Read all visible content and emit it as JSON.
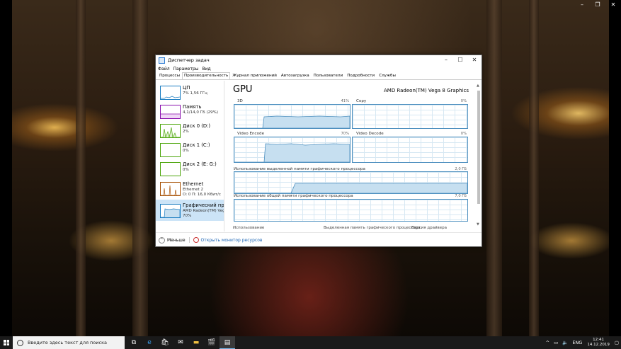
{
  "colors": {
    "cpu": "#1a7cc1",
    "memory": "#8b12ae",
    "disk": "#4da60c",
    "ethernet": "#a74f01",
    "gpu": "#1a7cc1",
    "graph_border": "#4c8fbf",
    "graph_fill": "#c6dff0",
    "selected_bg": "#cce4f7",
    "taskbar": "#1a1a1a"
  },
  "window": {
    "title": "Диспетчер задач",
    "menu": [
      "Файл",
      "Параметры",
      "Вид"
    ],
    "tabs": [
      "Процессы",
      "Производительность",
      "Журнал приложений",
      "Автозагрузка",
      "Пользователи",
      "Подробности",
      "Службы"
    ],
    "active_tab": "Производительность"
  },
  "sidebar": {
    "items": [
      {
        "name": "ЦП",
        "line1": "7% 1,56 ГГц",
        "line2": "",
        "color": "#1a7cc1",
        "icon": "cpu-thumbnail"
      },
      {
        "name": "Память",
        "line1": "4,1/14,0 ГБ (29%)",
        "line2": "",
        "color": "#8b12ae",
        "icon": "memory-thumbnail"
      },
      {
        "name": "Диск 0 (D:)",
        "line1": "2%",
        "line2": "",
        "color": "#4da60c",
        "icon": "disk-thumbnail"
      },
      {
        "name": "Диск 1 (C:)",
        "line1": "0%",
        "line2": "",
        "color": "#4da60c",
        "icon": "disk-thumbnail"
      },
      {
        "name": "Диск 2 (E: G:)",
        "line1": "0%",
        "line2": "",
        "color": "#4da60c",
        "icon": "disk-thumbnail"
      },
      {
        "name": "Ethernet",
        "line1": "Ethernet 2",
        "line2": "О: 0 П: 16,0 Кбит/с",
        "color": "#a74f01",
        "icon": "ethernet-thumbnail"
      },
      {
        "name": "Графический про",
        "line1": "AMD Radeon(TM) Vega",
        "line2": "70%",
        "color": "#1a7cc1",
        "icon": "gpu-thumbnail"
      }
    ],
    "selected": 6
  },
  "gpu": {
    "title": "GPU",
    "name": "AMD Radeon(TM) Vega 8 Graphics",
    "engines": [
      {
        "label": "3D",
        "value": "41%",
        "percent": 41
      },
      {
        "label": "Copy",
        "value": "0%",
        "percent": 0
      },
      {
        "label": "Video Encode",
        "value": "70%",
        "percent": 70
      },
      {
        "label": "Video Decode",
        "value": "0%",
        "percent": 0
      }
    ],
    "dedicated_label": "Использование выделенной памяти графического процессора",
    "dedicated_max": "2,0 ГБ",
    "shared_label": "Использование общей памяти графического процессора",
    "shared_max": "7,0 ГБ",
    "bottom": [
      "Использование",
      "Выделенная память графического процессора",
      "Версия драйвера"
    ]
  },
  "footer": {
    "less": "Меньше",
    "monitor_link": "Открыть монитор ресурсов"
  },
  "taskbar": {
    "search_placeholder": "Введите здесь текст для поиска",
    "lang": "ENG",
    "time": "12:41",
    "date": "14.12.2019"
  }
}
